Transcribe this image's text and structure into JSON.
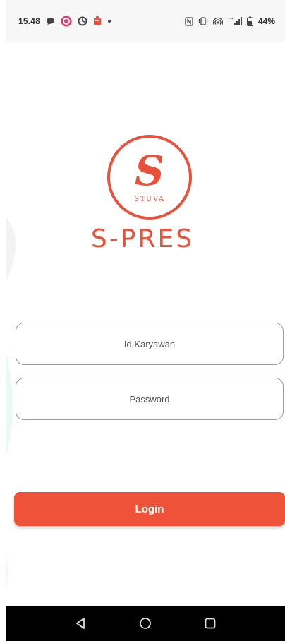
{
  "status_bar": {
    "time": "15.48",
    "battery": "44%",
    "left_icons": [
      "chat-icon",
      "app-circle-icon",
      "sync-icon",
      "app-box-icon",
      "dot-icon"
    ],
    "right_icons": [
      "nfc-icon",
      "vibrate-icon",
      "hotspot-icon",
      "signal-icon",
      "battery-icon"
    ]
  },
  "logo": {
    "letter": "S",
    "subtitle": "STUVA"
  },
  "brand": {
    "title": "S-PRES"
  },
  "form": {
    "id_placeholder": "Id Karyawan",
    "password_placeholder": "Password",
    "login_label": "Login"
  },
  "navbar": {
    "icons": [
      "back-icon",
      "home-icon",
      "recents-icon"
    ]
  },
  "colors": {
    "accent": "#ee5238",
    "brand_text": "#e8523b",
    "nav_bg": "#000000",
    "status_bg": "#f7f7f7"
  }
}
